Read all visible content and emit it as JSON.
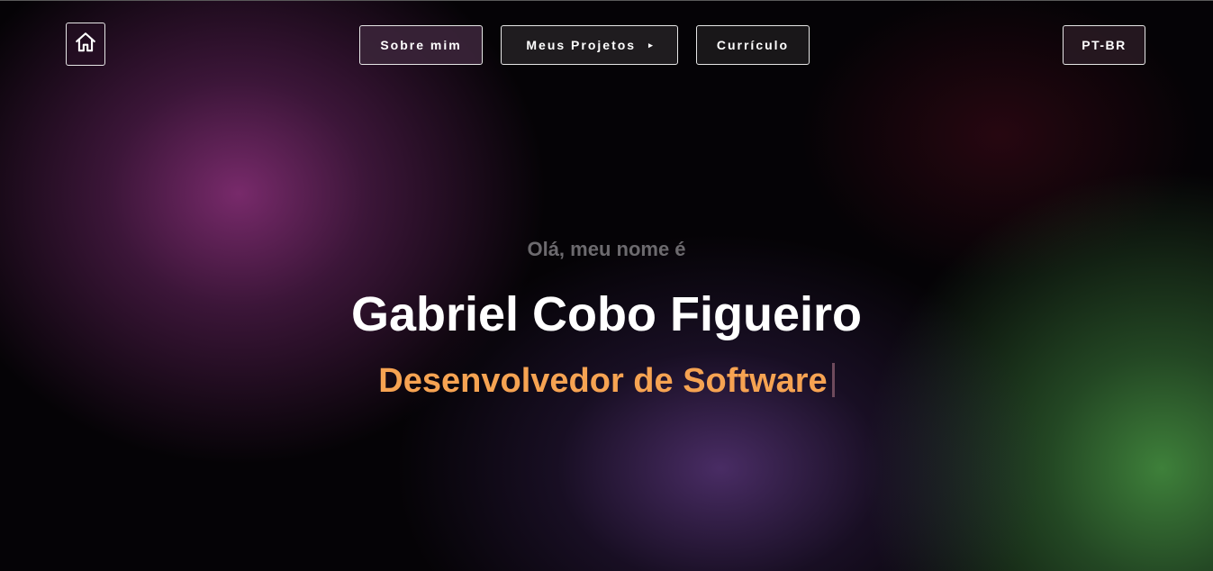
{
  "header": {
    "home_icon": "home-icon",
    "nav": {
      "about_label": "Sobre mim",
      "projects_label": "Meus Projetos",
      "projects_caret": "▸",
      "resume_label": "Currículo"
    },
    "language_label": "PT-BR"
  },
  "hero": {
    "greeting": "Olá, meu nome é",
    "name": "Gabriel Cobo Figueiro",
    "role": "Desenvolvedor de Software"
  },
  "colors": {
    "accent": "#f6a352",
    "text": "#ffffff",
    "muted": "#6c6a6e"
  }
}
